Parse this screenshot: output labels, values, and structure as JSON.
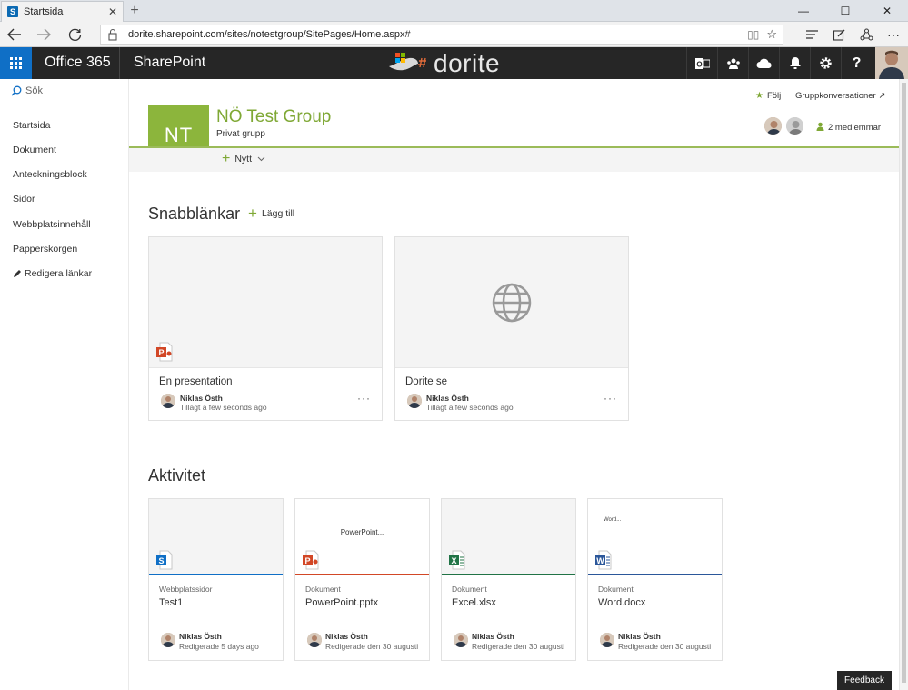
{
  "browser": {
    "tab_title": "Startsida",
    "tab_close": "✕",
    "new_tab": "+",
    "url": "dorite.sharepoint.com/sites/notestgroup/SitePages/Home.aspx#",
    "win_min": "—",
    "win_max": "☐",
    "win_close": "✕"
  },
  "suitebar": {
    "app_name": "Office 365",
    "site_name": "SharePoint",
    "logo_text": "dorite"
  },
  "leftnav": {
    "search_placeholder": "Sök",
    "items": [
      "Startsida",
      "Dokument",
      "Anteckningsblock",
      "Sidor",
      "Webbplatsinnehåll",
      "Papperskorgen"
    ],
    "edit_links": "Redigera länkar"
  },
  "header": {
    "follow": "Följ",
    "conversations": "Gruppkonversationer ↗",
    "initials": "NT",
    "group_name": "NÖ Test Group",
    "group_type": "Privat grupp",
    "members": "2 medlemmar",
    "new_button": "Nytt"
  },
  "quicklinks": {
    "heading": "Snabblänkar",
    "add_label": "Lägg till",
    "cards": [
      {
        "title": "En presentation",
        "person": "Niklas Östh",
        "meta": "Tillagt a few seconds ago",
        "icon": "powerpoint-icon"
      },
      {
        "title": "Dorite se",
        "person": "Niklas Östh",
        "meta": "Tillagt a few seconds ago",
        "icon": "globe-icon"
      }
    ]
  },
  "activity": {
    "heading": "Aktivitet",
    "cards": [
      {
        "type": "Webbplatssidor",
        "title": "Test1",
        "person": "Niklas Östh",
        "meta": "Redigerade 5 days ago",
        "preview": "",
        "color": "#0f6fc6",
        "icon": "sharepoint-page-icon"
      },
      {
        "type": "Dokument",
        "title": "PowerPoint.pptx",
        "person": "Niklas Östh",
        "meta": "Redigerade den 30 augusti",
        "preview": "PowerPoint...",
        "color": "#d24726",
        "icon": "powerpoint-icon"
      },
      {
        "type": "Dokument",
        "title": "Excel.xlsx",
        "person": "Niklas Östh",
        "meta": "Redigerade den 30 augusti",
        "preview": "",
        "color": "#217346",
        "icon": "excel-icon"
      },
      {
        "type": "Dokument",
        "title": "Word.docx",
        "person": "Niklas Östh",
        "meta": "Redigerade den 30 augusti",
        "preview": "Word...",
        "color": "#2b579a",
        "icon": "word-icon"
      }
    ]
  },
  "feedback": "Feedback"
}
